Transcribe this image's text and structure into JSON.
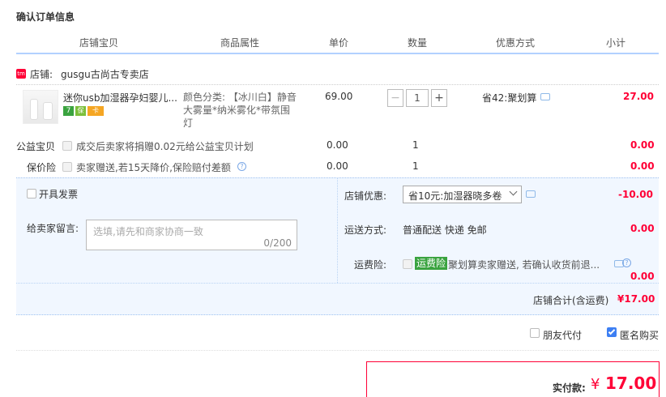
{
  "page_title": "确认订单信息",
  "columns": [
    "店铺宝贝",
    "商品属性",
    "单价",
    "数量",
    "优惠方式",
    "小计"
  ],
  "shop": {
    "badge": "tm",
    "label": "店铺:",
    "name": "gusgu古尚古专卖店"
  },
  "product": {
    "title": "迷你usb加湿器孕妇婴儿...",
    "badges": [
      "7",
      "保",
      "卡"
    ],
    "attr_line1": "颜色分类: 【冰川白】静音",
    "attr_line2": "大雾量*纳米雾化*带氛围",
    "attr_line3": "灯",
    "price": "69.00",
    "qty": "1",
    "promo": "省42:聚划算",
    "subtotal": "27.00"
  },
  "charity": {
    "label": "公益宝贝",
    "text": "成交后卖家将捐赠0.02元给公益宝贝计划",
    "price": "0.00",
    "qty": "1",
    "subtotal": "0.00"
  },
  "insurance": {
    "label": "保价险",
    "text": "卖家赠送,若15天降价,保险赔付差额",
    "price": "0.00",
    "qty": "1",
    "subtotal": "0.00"
  },
  "invoice_label": "开具发票",
  "message": {
    "label": "给卖家留言:",
    "placeholder": "选填,请先和商家协商一致",
    "counter": "0/200"
  },
  "shop_discount": {
    "label": "店铺优惠:",
    "selected": "省10元:加湿器晓多卷",
    "amount": "-10.00"
  },
  "shipping": {
    "label": "运送方式:",
    "value": "普通配送 快递 免邮",
    "amount": "0.00"
  },
  "freight_ins": {
    "label": "运费险:",
    "tag": "运费险",
    "text": "聚划算卖家赠送, 若确认收货前退...",
    "amount": "0.00"
  },
  "shop_total": {
    "label": "店铺合计(含运费)",
    "value": "¥17.00"
  },
  "options": {
    "friend_pay": "朋友代付",
    "anonymous": "匿名购买"
  },
  "payment": {
    "label": "实付款:",
    "currency": "¥",
    "amount": "17.00"
  },
  "colors": {
    "accent": "#ff0036",
    "blue_line": "#b2d1ff",
    "panel_bg": "#f1f7ff",
    "green_tag": "#3aa33f"
  }
}
